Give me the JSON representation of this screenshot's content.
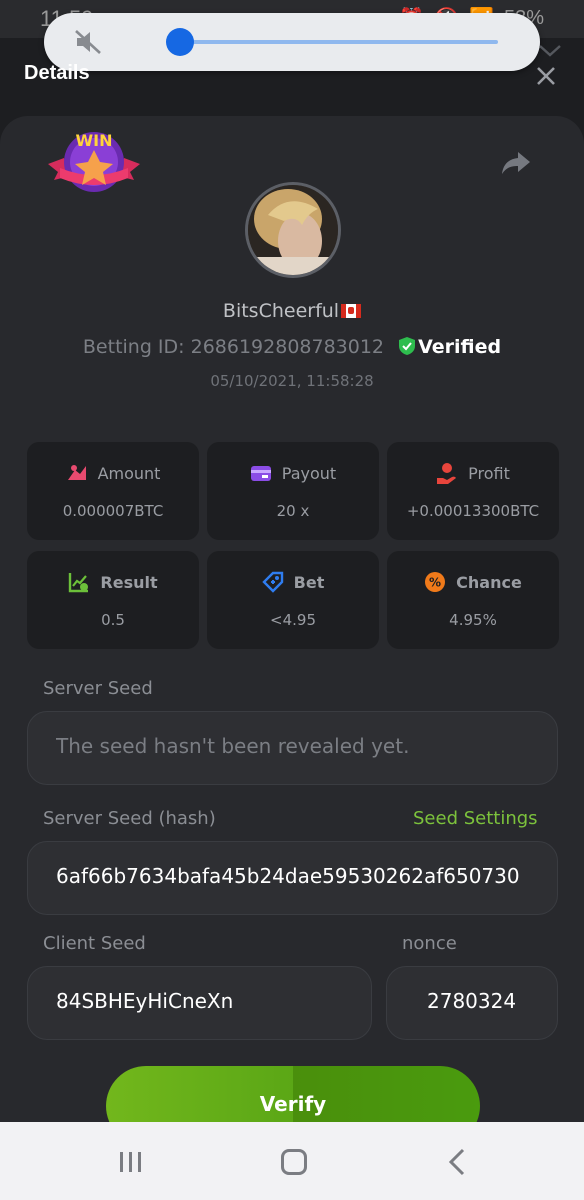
{
  "status_bar": {
    "time": "11:59",
    "voicemail": "oo",
    "battery": "53%"
  },
  "volume_panel": {
    "level": 0.04
  },
  "header": {
    "title": "Details"
  },
  "bet": {
    "username": "BitsCheerful",
    "betting_id": "Betting ID: 2686192808783012",
    "verified": "Verified",
    "datetime": "05/10/2021, 11:58:28"
  },
  "stats": [
    {
      "label": "Amount",
      "value": "0.000007BTC",
      "icon": "amount-icon",
      "color": "#e84a6f"
    },
    {
      "label": "Payout",
      "value": "20 x",
      "icon": "payout-icon",
      "color": "#8b4de6"
    },
    {
      "label": "Profit",
      "value": "+0.00013300BTC",
      "icon": "profit-icon",
      "color": "#e8453c"
    },
    {
      "label": "Result",
      "value": "0.5",
      "icon": "result-icon",
      "color": "#6cc03a"
    },
    {
      "label": "Bet",
      "value": "<4.95",
      "icon": "bet-icon",
      "color": "#2f7df0"
    },
    {
      "label": "Chance",
      "value": "4.95%",
      "icon": "chance-icon",
      "color": "#f07a1a"
    }
  ],
  "server_seed": {
    "label": "Server Seed",
    "placeholder": "The seed hasn't been revealed yet."
  },
  "server_seed_hash": {
    "label": "Server Seed (hash)",
    "link": "Seed Settings",
    "value": "6af66b7634bafa45b24dae59530262af650730"
  },
  "client_seed": {
    "label": "Client Seed",
    "value": "84SBHEyHiCneXn"
  },
  "nonce": {
    "label": "nonce",
    "value": "2780324"
  },
  "verify_button": {
    "label": "Verify"
  },
  "colors": {
    "accent": "#7cc23c",
    "background": "#1d1e21",
    "sheet": "#28292d",
    "verified_shield": "#2ebd4e"
  }
}
